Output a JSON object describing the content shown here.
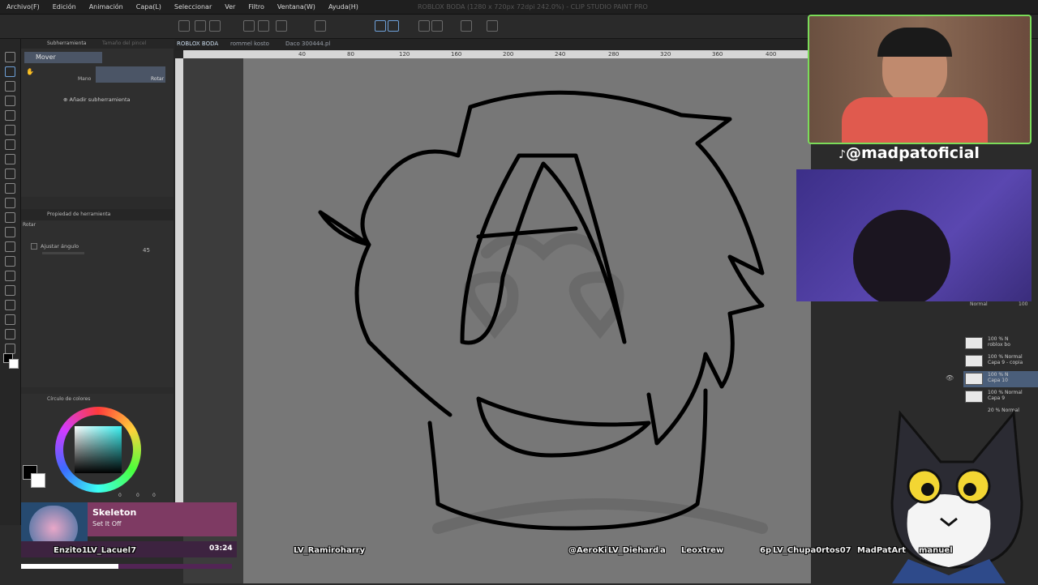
{
  "app": {
    "title": "ROBLOX BODA (1280 x 720px 72dpi 242.0%) - CLIP STUDIO PAINT PRO"
  },
  "menu": [
    "Archivo(F)",
    "Edición",
    "Animación",
    "Capa(L)",
    "Seleccionar",
    "Ver",
    "Filtro",
    "Ventana(W)",
    "Ayuda(H)"
  ],
  "subtool": {
    "tab_label": "Subherramienta",
    "tab2_label": "Tamaño del pincel",
    "active_item": "Mover",
    "mano_label": "Mano",
    "rotar_label": "Rotar",
    "add_label": "Añadir subherramienta"
  },
  "toolprop": {
    "header": "Propiedad de herramienta",
    "section": "Rotar",
    "angle_label": "Ajustar ángulo",
    "angle_value": "45"
  },
  "colorpanel": {
    "header": "Círculo de colores",
    "values": [
      "0",
      "0",
      "0"
    ]
  },
  "canvas_tabs": [
    "ROBLOX BODA",
    "rommel kosto",
    "Daco 300444.pl"
  ],
  "ruler_ticks": [
    "40",
    "80",
    "120",
    "160",
    "200",
    "240",
    "280",
    "320",
    "360",
    "400"
  ],
  "layers": {
    "blend": "Normal",
    "opacity": "100",
    "items": [
      {
        "line1": "100 % N",
        "line2": "roblox bo"
      },
      {
        "line1": "100 % Normal",
        "line2": "Capa 9 - copia"
      },
      {
        "line1": "100 % N",
        "line2": "Capa 10"
      },
      {
        "line1": "100 % Normal",
        "line2": "Capa 9"
      },
      {
        "line1": "20 % Normal",
        "line2": ""
      }
    ]
  },
  "stream": {
    "tiktok_handle": "@madpatoficial",
    "song_title": "Skeleton",
    "song_artist": "Set It Off",
    "song_time": "03:24",
    "chat_names": [
      "Enzito1",
      "LV_Lacuel7",
      "LV_Ramiroharry",
      "@AeroKi",
      "LV_Diehard",
      "a",
      "Leoxtrew",
      "6p",
      "LV_Chupa0rtos07",
      "MadPatArt",
      "manuel"
    ]
  },
  "colors": {
    "accent_green": "#7bdc5a",
    "song_card": "#7e3a63",
    "canvas_gray": "#777777"
  }
}
